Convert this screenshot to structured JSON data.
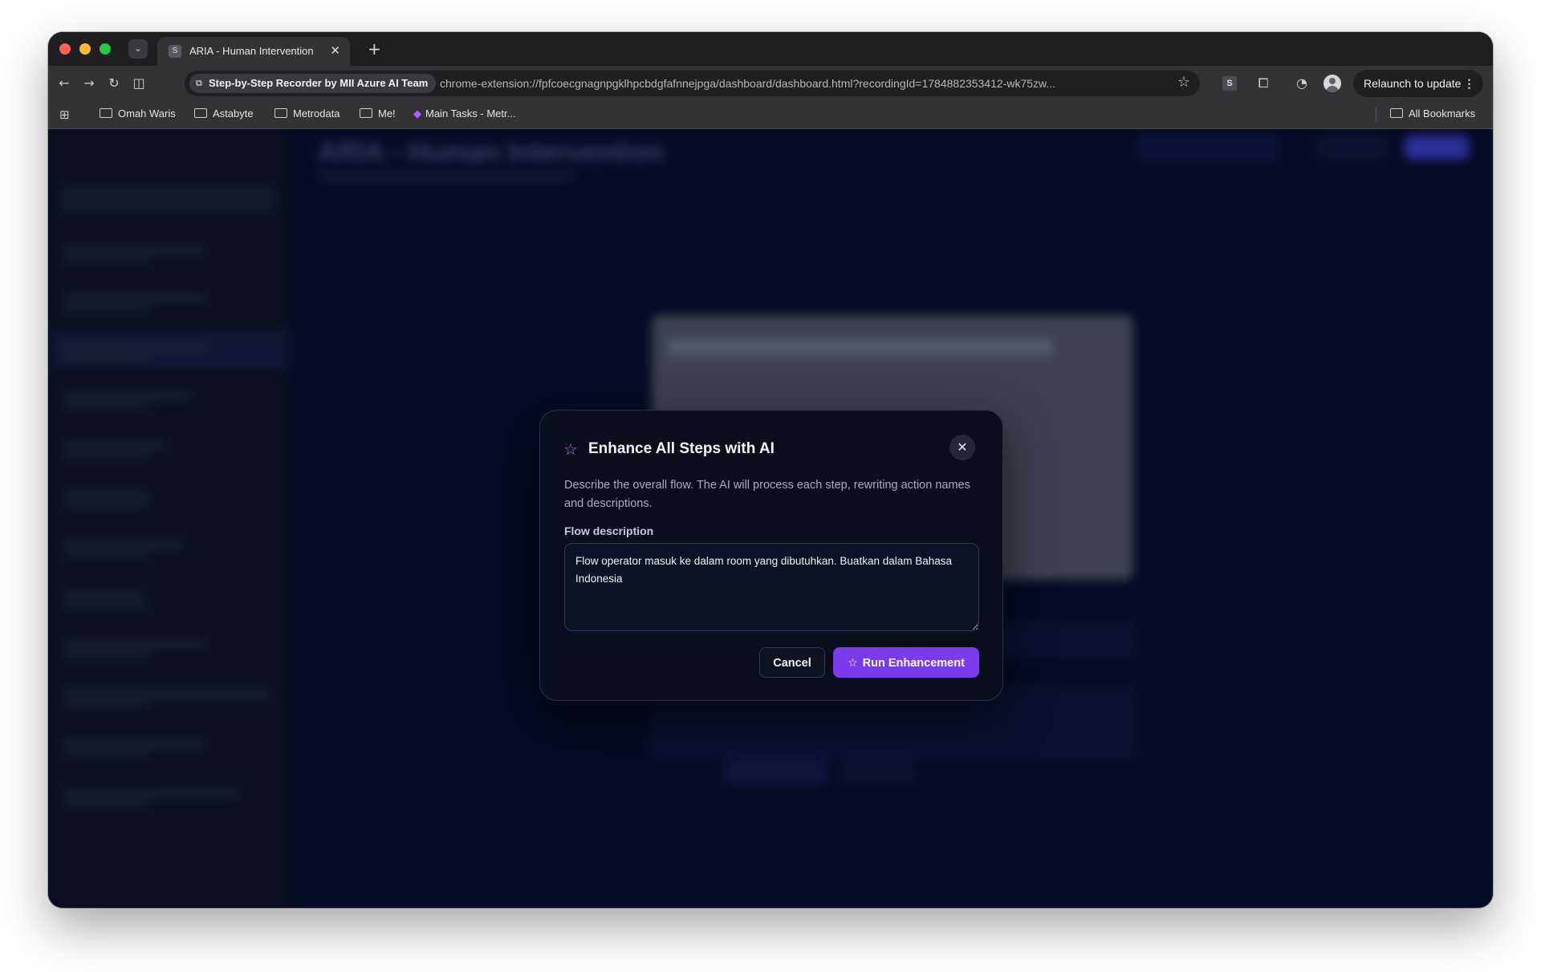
{
  "browser": {
    "tab_title": "ARIA - Human Intervention",
    "tab_favicon": "S",
    "site_chip": "Step-by-Step Recorder by MII Azure AI Team",
    "url": "chrome-extension://fpfcoecgnagnpgklhpcbdgfafnnejpga/dashboard/dashboard.html?recordingId=1784882353412-wk75zw...",
    "extension_badge": "S",
    "relaunch_label": "Relaunch to update",
    "bookmarks": [
      "Omah Waris",
      "Astabyte",
      "Metrodata",
      "Me!",
      "Main Tasks - Metr..."
    ],
    "all_bookmarks": "All Bookmarks",
    "icons": {
      "tab_search": "chevron-down-icon",
      "back": "arrow-left-icon",
      "forward": "arrow-right-icon",
      "reload": "reload-icon",
      "side_panel": "side-panel-icon",
      "bookmark": "star-icon",
      "extensions": "puzzle-icon",
      "apps": "grid-icon"
    }
  },
  "background_page": {
    "title": "ARIA - Human Intervention"
  },
  "modal": {
    "title": "Enhance All Steps with AI",
    "description": "Describe the overall flow. The AI will process each step, rewriting action names and descriptions.",
    "field_label": "Flow description",
    "field_value": "Flow operator masuk ke dalam room yang dibutuhkan. Buatkan dalam Bahasa Indonesia",
    "cancel_label": "Cancel",
    "run_label": "Run Enhancement",
    "accent_color": "#7c3aed",
    "icons": {
      "title": "sparkle-star-icon",
      "close": "close-icon",
      "run": "sparkle-star-icon"
    }
  }
}
